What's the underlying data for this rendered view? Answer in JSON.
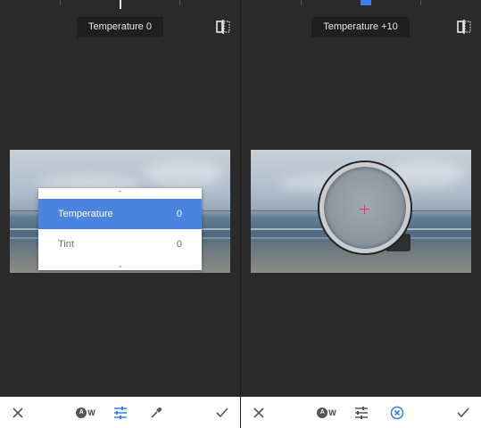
{
  "left_panel": {
    "adjustment_label": "Temperature 0",
    "menu": {
      "items": [
        {
          "label": "Temperature",
          "value": "0",
          "selected": true
        },
        {
          "label": "Tint",
          "value": "0",
          "selected": false
        }
      ]
    },
    "toolbar": {
      "auto_wb_label": "W",
      "auto_wb_letter": "A"
    }
  },
  "right_panel": {
    "adjustment_label": "Temperature +10",
    "toolbar": {
      "auto_wb_label": "W",
      "auto_wb_letter": "A"
    }
  },
  "colors": {
    "accent": "#3b7cf0",
    "selected_row": "#4a83e0",
    "crosshair": "#e23b3b"
  },
  "icons": {
    "cancel": "close-icon",
    "auto_white_balance": "auto-wb-icon",
    "adjust": "sliders-icon",
    "eyedropper": "eyedropper-icon",
    "apply": "checkmark-icon",
    "compare": "compare-icon"
  }
}
